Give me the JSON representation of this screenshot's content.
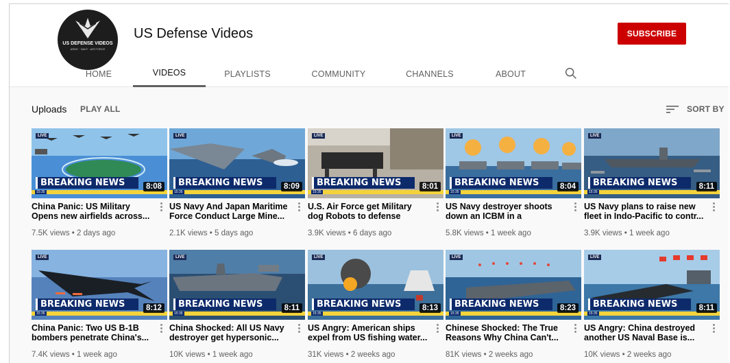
{
  "channel": {
    "name": "US Defense Videos",
    "logo_text": "US DEFENSE VIDEOS",
    "subscribe_label": "SUBSCRIBE"
  },
  "tabs": [
    {
      "label": "HOME"
    },
    {
      "label": "VIDEOS"
    },
    {
      "label": "PLAYLISTS"
    },
    {
      "label": "COMMUNITY"
    },
    {
      "label": "CHANNELS"
    },
    {
      "label": "ABOUT"
    }
  ],
  "active_tab": "VIDEOS",
  "uploads": {
    "title": "Uploads",
    "play_all": "PLAY ALL",
    "sort_label": "SORT BY"
  },
  "thumb_labels": {
    "live": "LIVE",
    "breaking": "BREAKING NEWS",
    "clock": "15:35"
  },
  "colors": {
    "subscribe": "#cc0000",
    "breaking_bar": "#0d2a6b",
    "ticker": "#f4d33b"
  },
  "videos": [
    {
      "title": "China Panic: US Military Opens new airfields across...",
      "stats": "7.5K views • 2 days ago",
      "duration": "8:08",
      "theme": "island"
    },
    {
      "title": "US Navy And Japan Maritime Force Conduct Large Mine...",
      "stats": "2.1K views • 5 days ago",
      "duration": "8:09",
      "theme": "ships"
    },
    {
      "title": "U.S. Air Force get Military dog Robots to defense from...",
      "stats": "3.9K views • 6 days ago",
      "duration": "8:01",
      "theme": "robot"
    },
    {
      "title": "US Navy destroyer shoots down an ICBM in a mileston...",
      "stats": "5.8K views • 1 week ago",
      "duration": "8:04",
      "theme": "missiles"
    },
    {
      "title": "US Navy plans to raise new fleet in Indo-Pacific to contr...",
      "stats": "3.9K views • 1 week ago",
      "duration": "8:11",
      "theme": "fleet"
    },
    {
      "title": "China Panic: Two US B-1B bombers penetrate China's...",
      "stats": "7.4K views • 1 week ago",
      "duration": "8:12",
      "theme": "bomber"
    },
    {
      "title": "China Shocked: All US Navy destroyer get hypersonic...",
      "stats": "10K views • 1 week ago",
      "duration": "8:11",
      "theme": "destroyer"
    },
    {
      "title": "US Angry: American ships expel from US fishing water...",
      "stats": "31K views • 2 weeks ago",
      "duration": "8:13",
      "theme": "explosion"
    },
    {
      "title": "Chinese Shocked: The True Reasons Why China Can't...",
      "stats": "81K views • 2 weeks ago",
      "duration": "8:23",
      "theme": "carrier"
    },
    {
      "title": "US Angry: China destroyed another US Naval Base is...",
      "stats": "10K views • 2 weeks ago",
      "duration": "8:11",
      "theme": "flags"
    }
  ]
}
